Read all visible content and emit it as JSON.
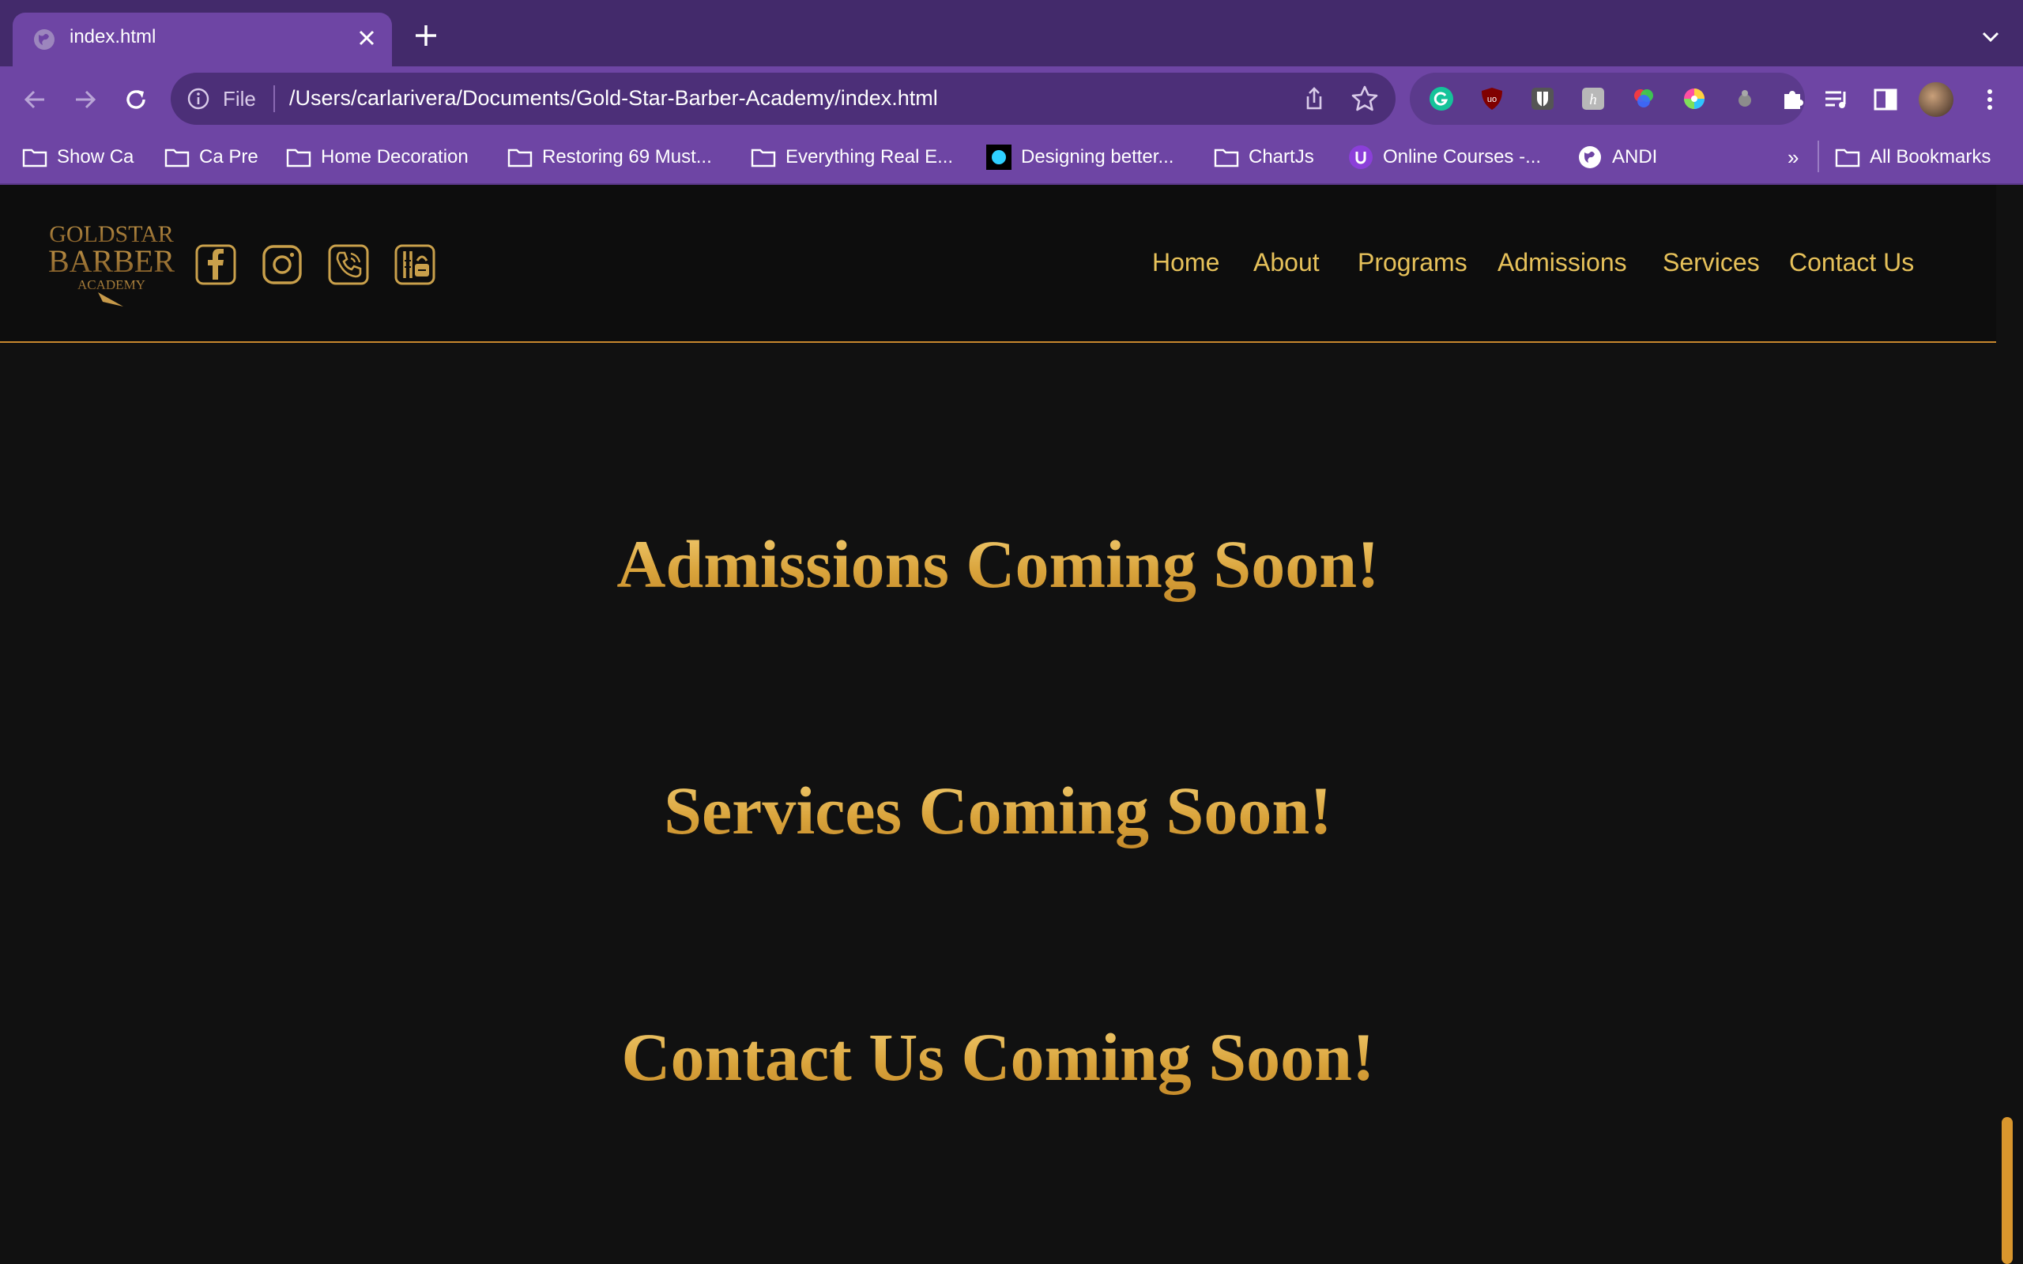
{
  "browser": {
    "tab_title": "index.html",
    "url_scheme_label": "File",
    "url": "/Users/carlarivera/Documents/Gold-Star-Barber-Academy/index.html",
    "icons": {
      "back": "back-arrow-icon",
      "forward": "forward-arrow-icon",
      "reload": "reload-icon",
      "share": "share-icon",
      "bookmark_star": "star-icon",
      "extensions": "puzzle-icon",
      "menu": "kebab-icon"
    },
    "bookmarks": [
      {
        "label": "Show Ca",
        "icon": "folder-icon"
      },
      {
        "label": "Ca Pre",
        "icon": "folder-icon"
      },
      {
        "label": "Home Decoration",
        "icon": "folder-icon"
      },
      {
        "label": "Restoring 69 Must...",
        "icon": "folder-icon"
      },
      {
        "label": "Everything Real E...",
        "icon": "folder-icon"
      },
      {
        "label": "Designing better...",
        "icon": "site-icon"
      },
      {
        "label": "ChartJs",
        "icon": "folder-icon"
      },
      {
        "label": "Online Courses -...",
        "icon": "site-icon"
      },
      {
        "label": "ANDI",
        "icon": "globe-icon"
      }
    ],
    "overflow_label": "»",
    "all_bookmarks_label": "All Bookmarks"
  },
  "site": {
    "logo_text": [
      "GOLDSTAR",
      "BARBER",
      "ACADEMY"
    ],
    "social": [
      "facebook-icon",
      "instagram-icon",
      "phone-icon",
      "booking-icon"
    ],
    "nav": [
      "Home",
      "About",
      "Programs",
      "Admissions",
      "Services",
      "Contact Us"
    ],
    "sections": [
      "Admissions Coming Soon!",
      "Services Coming Soon!",
      "Contact Us Coming Soon!"
    ],
    "colors": {
      "gold": "#e6c15a",
      "background": "#111111",
      "browser_purple": "#6e45a4"
    }
  }
}
